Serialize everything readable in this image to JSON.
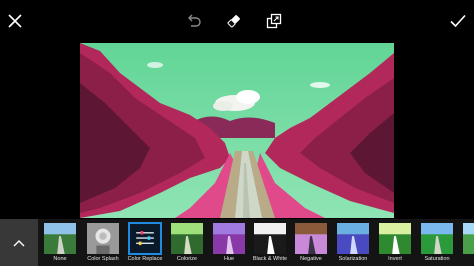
{
  "toolbar": {
    "close_icon": "close-icon",
    "undo_icon": "undo-icon",
    "eraser_icon": "eraser-icon",
    "compare_icon": "compare-icon",
    "apply_icon": "checkmark-icon"
  },
  "colors": {
    "sky": "#69d49a",
    "foliage": "#c0285c",
    "selected_border": "#1e8be0",
    "panel": "#141414",
    "expand_button": "#383838"
  },
  "effects": [
    {
      "label": "None",
      "selected": false
    },
    {
      "label": "Color Splash",
      "selected": false
    },
    {
      "label": "Color Replace",
      "selected": true
    },
    {
      "label": "Colorize",
      "selected": false
    },
    {
      "label": "Hue",
      "selected": false
    },
    {
      "label": "Black & White",
      "selected": false
    },
    {
      "label": "Negative",
      "selected": false
    },
    {
      "label": "Solarization",
      "selected": false
    },
    {
      "label": "Invert",
      "selected": false
    },
    {
      "label": "Saturation",
      "selected": false
    },
    {
      "label": "Bri",
      "selected": false
    }
  ]
}
